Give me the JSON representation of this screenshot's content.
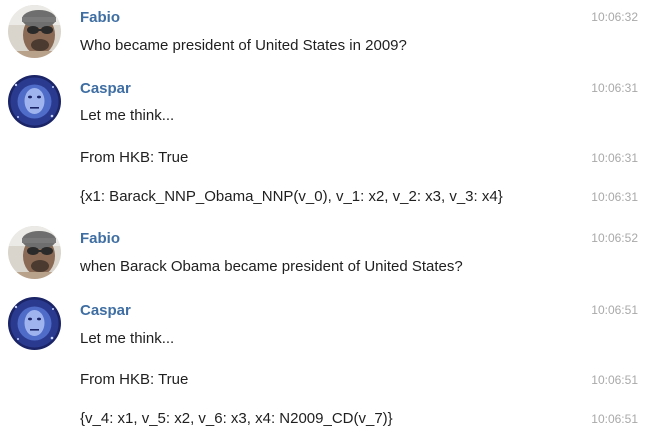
{
  "messages": [
    {
      "author": "Fabio",
      "avatar": "fabio-avatar",
      "lines": [
        {
          "text": "Who became president of United States in 2009?",
          "time": "10:06:32"
        }
      ]
    },
    {
      "author": "Caspar",
      "avatar": "caspar-avatar",
      "lines": [
        {
          "text": "Let me think...",
          "time": "10:06:31"
        },
        {
          "text": "From HKB: True",
          "time": "10:06:31"
        },
        {
          "text": "{x1: Barack_NNP_Obama_NNP(v_0), v_1: x2, v_2: x3, v_3: x4}",
          "time": "10:06:31"
        }
      ]
    },
    {
      "author": "Fabio",
      "avatar": "fabio-avatar",
      "lines": [
        {
          "text": "when Barack Obama became president of United States?",
          "time": "10:06:52"
        }
      ]
    },
    {
      "author": "Caspar",
      "avatar": "caspar-avatar",
      "lines": [
        {
          "text": "Let me think...",
          "time": "10:06:51"
        },
        {
          "text": "From HKB: True",
          "time": "10:06:51"
        },
        {
          "text": "{v_4: x1, v_5: x2, v_6: x3, x4: N2009_CD(v_7)}",
          "time": "10:06:51"
        }
      ]
    }
  ],
  "colors": {
    "author": "#3f6ea3",
    "text": "#1f1f1f",
    "time": "#a9a9a9"
  }
}
